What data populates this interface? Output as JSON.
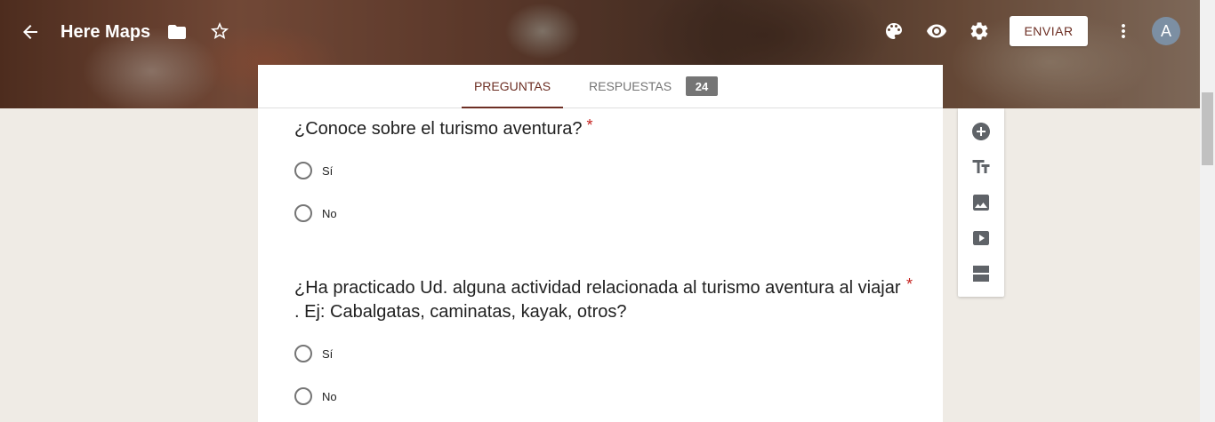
{
  "header": {
    "title": "Here Maps",
    "send_label": "ENVIAR",
    "avatar_letter": "A"
  },
  "tabs": {
    "questions_label": "PREGUNTAS",
    "responses_label": "RESPUESTAS",
    "responses_count": "24"
  },
  "questions": [
    {
      "title": "¿Conoce sobre el turismo aventura?",
      "required_mark": "*",
      "options": [
        "Sí",
        "No"
      ]
    },
    {
      "title_line1": "¿Ha practicado Ud. alguna actividad relacionada al turismo aventura al viajar",
      "title_line2": ". Ej: Cabalgatas, caminatas, kayak, otros?",
      "required_mark": "*",
      "options": [
        "Sí",
        "No"
      ]
    }
  ],
  "colors": {
    "accent": "#6d2f24",
    "background": "#efebe5",
    "required": "#c5221f"
  },
  "icons": {
    "toolbar": [
      "add-question-icon",
      "title-text-icon",
      "image-icon",
      "video-icon",
      "section-icon"
    ]
  }
}
